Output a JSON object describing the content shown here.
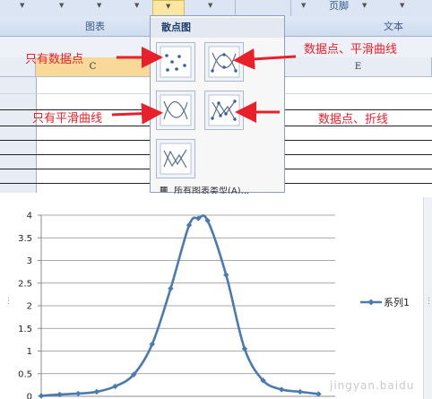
{
  "ribbon": {
    "groups": [
      "图表",
      "页脚",
      "文本"
    ]
  },
  "dropdown": {
    "title": "散点图",
    "footer": "所有图表类型(A)...",
    "options": [
      {
        "name": "scatter-markers-only"
      },
      {
        "name": "scatter-smooth-lines-markers"
      },
      {
        "name": "scatter-smooth-lines"
      },
      {
        "name": "scatter-straight-lines-markers"
      },
      {
        "name": "scatter-straight-lines"
      }
    ]
  },
  "columns": {
    "c": "C",
    "e": "E"
  },
  "annotations": {
    "markers_only": "只有数据点",
    "smooth_markers": "数据点、平滑曲线",
    "smooth_only": "只有平滑曲线",
    "straight_markers": "数据点、折线"
  },
  "colors": {
    "annotation": "#e8202a",
    "series": "#4a7ab0"
  },
  "chart_data": {
    "type": "scatter",
    "title": "",
    "xlabel": "",
    "ylabel": "",
    "ylim": [
      0,
      4
    ],
    "yticks": [
      "4",
      "3.5",
      "3",
      "2.5",
      "2",
      "1.5",
      "1",
      "0.5",
      "0"
    ],
    "grid": true,
    "legend": "right",
    "series": [
      {
        "name": "系列1",
        "x": [
          1,
          2,
          3,
          4,
          5,
          6,
          7,
          8,
          9,
          9.5,
          10,
          11,
          12,
          13,
          14,
          15,
          16
        ],
        "y": [
          0.01,
          0.04,
          0.06,
          0.1,
          0.22,
          0.48,
          1.15,
          2.38,
          3.78,
          3.93,
          3.88,
          2.68,
          1.05,
          0.35,
          0.15,
          0.1,
          0.05
        ]
      }
    ],
    "xlim": [
      1,
      16.9
    ]
  },
  "watermark": "jingyan.baidu"
}
